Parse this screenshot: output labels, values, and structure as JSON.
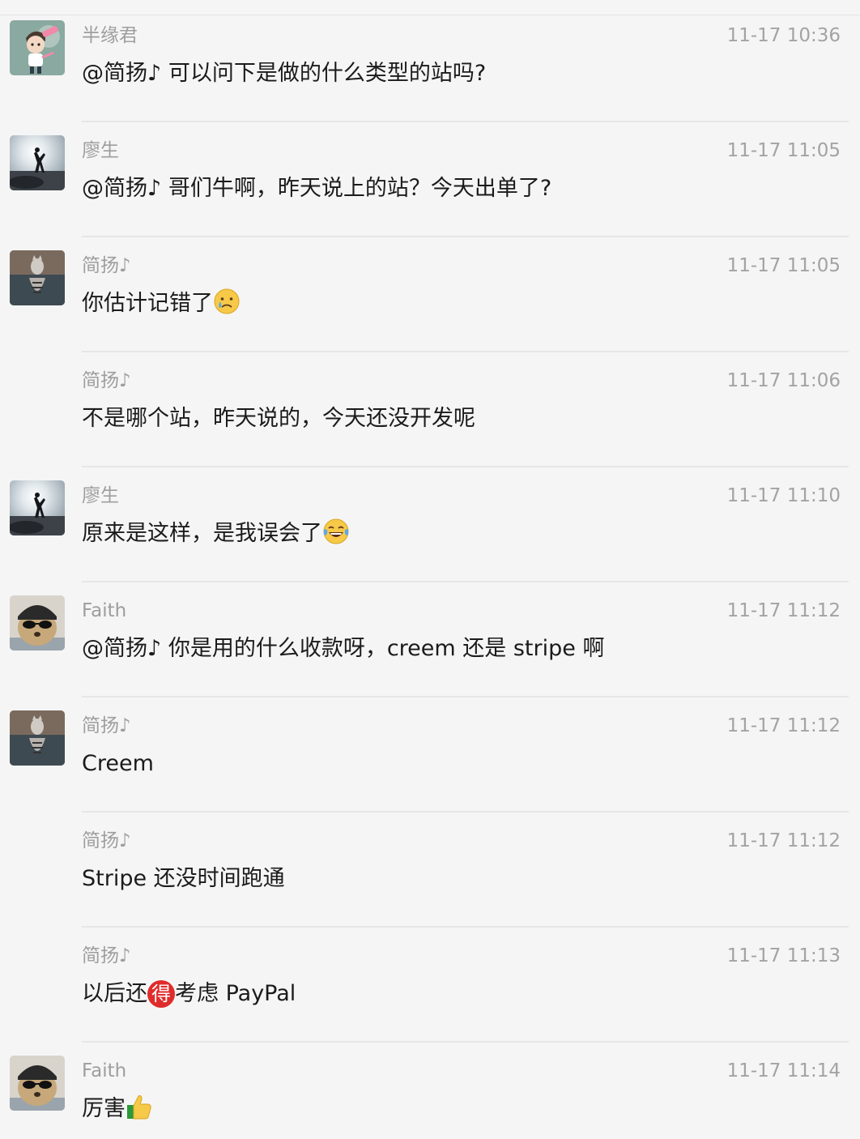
{
  "messages": [
    {
      "sender": "半缘君",
      "time": "11-17 10:36",
      "avatar": "cartoon-boy-avatar",
      "text": "@简扬♪ 可以问下是做的什么类型的站吗?"
    },
    {
      "sender": "廖生",
      "time": "11-17 11:05",
      "avatar": "beach-silhouette-avatar",
      "text": "@简扬♪ 哥们牛啊，昨天说上的站？今天出单了?"
    },
    {
      "sender": "简扬♪",
      "time": "11-17 11:05",
      "avatar": "cat-tiger-reflection-avatar",
      "text": "你估计记错了",
      "emoji": "crying-face-emoji"
    },
    {
      "sender": "简扬♪",
      "time": "11-17 11:06",
      "text": "不是哪个站，昨天说的，今天还没开发呢"
    },
    {
      "sender": "廖生",
      "time": "11-17 11:10",
      "avatar": "beach-silhouette-avatar",
      "text": "原来是这样，是我误会了",
      "emoji": "tears-of-joy-emoji"
    },
    {
      "sender": "Faith",
      "time": "11-17 11:12",
      "avatar": "dog-sunglasses-avatar",
      "text": "@简扬♪ 你是用的什么收款呀，creem 还是 stripe 啊"
    },
    {
      "sender": "简扬♪",
      "time": "11-17 11:12",
      "avatar": "cat-tiger-reflection-avatar",
      "text": "Creem"
    },
    {
      "sender": "简扬♪",
      "time": "11-17 11:12",
      "text": "Stripe 还没时间跑通"
    },
    {
      "sender": "简扬♪",
      "time": "11-17 11:13",
      "text_before": "以后还",
      "badge": "得",
      "text_after": "考虑 PayPal"
    },
    {
      "sender": "Faith",
      "time": "11-17 11:14",
      "avatar": "dog-sunglasses-avatar",
      "text": "厉害",
      "emoji": "thumbs-up-emoji"
    }
  ]
}
